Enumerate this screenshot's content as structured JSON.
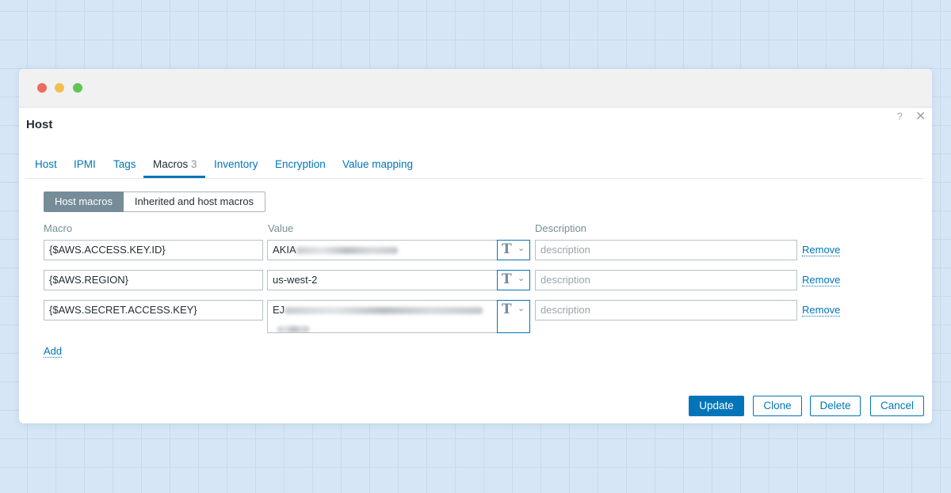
{
  "dialog": {
    "title": "Host",
    "help_glyph": "?",
    "close_glyph": "✕"
  },
  "tabs": [
    {
      "label": "Host"
    },
    {
      "label": "IPMI"
    },
    {
      "label": "Tags"
    },
    {
      "label": "Macros",
      "count": "3",
      "active": true
    },
    {
      "label": "Inventory"
    },
    {
      "label": "Encryption"
    },
    {
      "label": "Value mapping"
    }
  ],
  "segments": {
    "host_macros": "Host macros",
    "inherited": "Inherited and host macros"
  },
  "columns": {
    "macro": "Macro",
    "value": "Value",
    "description": "Description"
  },
  "rows": [
    {
      "macro": "{$AWS.ACCESS.KEY.ID}",
      "value": "AKIA",
      "value_obscured": true,
      "type_glyph": "T",
      "description_placeholder": "description",
      "remove": "Remove"
    },
    {
      "macro": "{$AWS.REGION}",
      "value": "us-west-2",
      "value_obscured": false,
      "type_glyph": "T",
      "description_placeholder": "description",
      "remove": "Remove"
    },
    {
      "macro": "{$AWS.SECRET.ACCESS.KEY}",
      "value": "EJ",
      "value_obscured": true,
      "type_glyph": "T",
      "description_placeholder": "description",
      "remove": "Remove"
    }
  ],
  "add_label": "Add",
  "buttons": {
    "update": "Update",
    "clone": "Clone",
    "delete": "Delete",
    "cancel": "Cancel"
  },
  "colors": {
    "accent": "#0275b8",
    "segment_active": "#768d99",
    "title": "#1f2c33"
  },
  "icons": {
    "type_selector": "text-type-icon",
    "chevron": "chevron-down-icon"
  }
}
